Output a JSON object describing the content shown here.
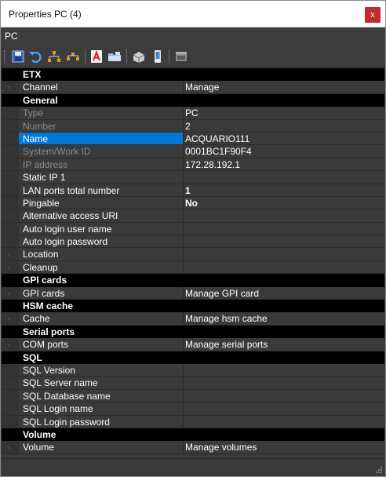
{
  "window": {
    "title": "Properties PC (4)",
    "close_glyph": "x"
  },
  "subheader": {
    "text": "PC"
  },
  "toolbar": {
    "buttons": [
      {
        "name": "save-icon"
      },
      {
        "name": "undo-icon"
      },
      {
        "name": "hierarchy-down-icon"
      },
      {
        "name": "hierarchy-up-icon"
      },
      {
        "name": "text-a-icon"
      },
      {
        "name": "open-folder-icon"
      },
      {
        "name": "package-icon"
      },
      {
        "name": "device-icon"
      },
      {
        "name": "window-icon"
      }
    ]
  },
  "grid": {
    "rows": [
      {
        "kind": "category",
        "label": "ETX"
      },
      {
        "kind": "prop",
        "label": "Channel",
        "value": "Manage",
        "expander": true,
        "style": "normal"
      },
      {
        "kind": "category",
        "label": "General"
      },
      {
        "kind": "prop",
        "label": "Type",
        "value": "PC",
        "style": "disabled"
      },
      {
        "kind": "prop",
        "label": "Number",
        "value": "2",
        "style": "disabled"
      },
      {
        "kind": "prop",
        "label": "Name",
        "value": "ACQUARIO111",
        "style": "normal",
        "selected": true
      },
      {
        "kind": "prop",
        "label": "System/Work ID",
        "value": "0001BC1F90F4",
        "style": "disabled"
      },
      {
        "kind": "prop",
        "label": "IP address",
        "value": "172.28.192.1",
        "style": "disabled"
      },
      {
        "kind": "prop",
        "label": "Static IP 1",
        "value": "",
        "style": "normal"
      },
      {
        "kind": "prop",
        "label": "LAN ports total number",
        "value": "1",
        "style": "normal",
        "bold_value": true
      },
      {
        "kind": "prop",
        "label": "Pingable",
        "value": "No",
        "style": "normal",
        "bold_value": true
      },
      {
        "kind": "prop",
        "label": "Alternative access URI",
        "value": "",
        "style": "normal"
      },
      {
        "kind": "prop",
        "label": "Auto login user name",
        "value": "",
        "style": "normal"
      },
      {
        "kind": "prop",
        "label": "Auto login password",
        "value": "",
        "style": "normal"
      },
      {
        "kind": "prop",
        "label": "Location",
        "value": "",
        "expander": true,
        "style": "normal"
      },
      {
        "kind": "prop",
        "label": "Cleanup",
        "value": "",
        "expander": true,
        "style": "normal"
      },
      {
        "kind": "category",
        "label": "GPI cards"
      },
      {
        "kind": "prop",
        "label": "GPI cards",
        "value": "Manage GPI card",
        "expander": true,
        "style": "normal"
      },
      {
        "kind": "category",
        "label": "HSM cache"
      },
      {
        "kind": "prop",
        "label": "Cache",
        "value": "Manage hsm cache",
        "expander": true,
        "style": "normal"
      },
      {
        "kind": "category",
        "label": "Serial ports"
      },
      {
        "kind": "prop",
        "label": "COM ports",
        "value": "Manage serial ports",
        "expander": true,
        "style": "normal"
      },
      {
        "kind": "category",
        "label": "SQL"
      },
      {
        "kind": "prop",
        "label": "SQL Version",
        "value": "",
        "style": "normal"
      },
      {
        "kind": "prop",
        "label": "SQL Server name",
        "value": "",
        "style": "normal"
      },
      {
        "kind": "prop",
        "label": "SQL Database name",
        "value": "",
        "style": "normal"
      },
      {
        "kind": "prop",
        "label": "SQL Login name",
        "value": "",
        "style": "normal"
      },
      {
        "kind": "prop",
        "label": "SQL Login password",
        "value": "",
        "style": "normal"
      },
      {
        "kind": "category",
        "label": "Volume"
      },
      {
        "kind": "prop",
        "label": "Volume",
        "value": "Manage volumes",
        "expander": true,
        "style": "normal"
      }
    ]
  },
  "colors": {
    "background": "#3a3a3a",
    "category": "#000000",
    "selection": "#0078d7",
    "disabled_text": "#8c8c8c",
    "close_button": "#c42b2b"
  }
}
